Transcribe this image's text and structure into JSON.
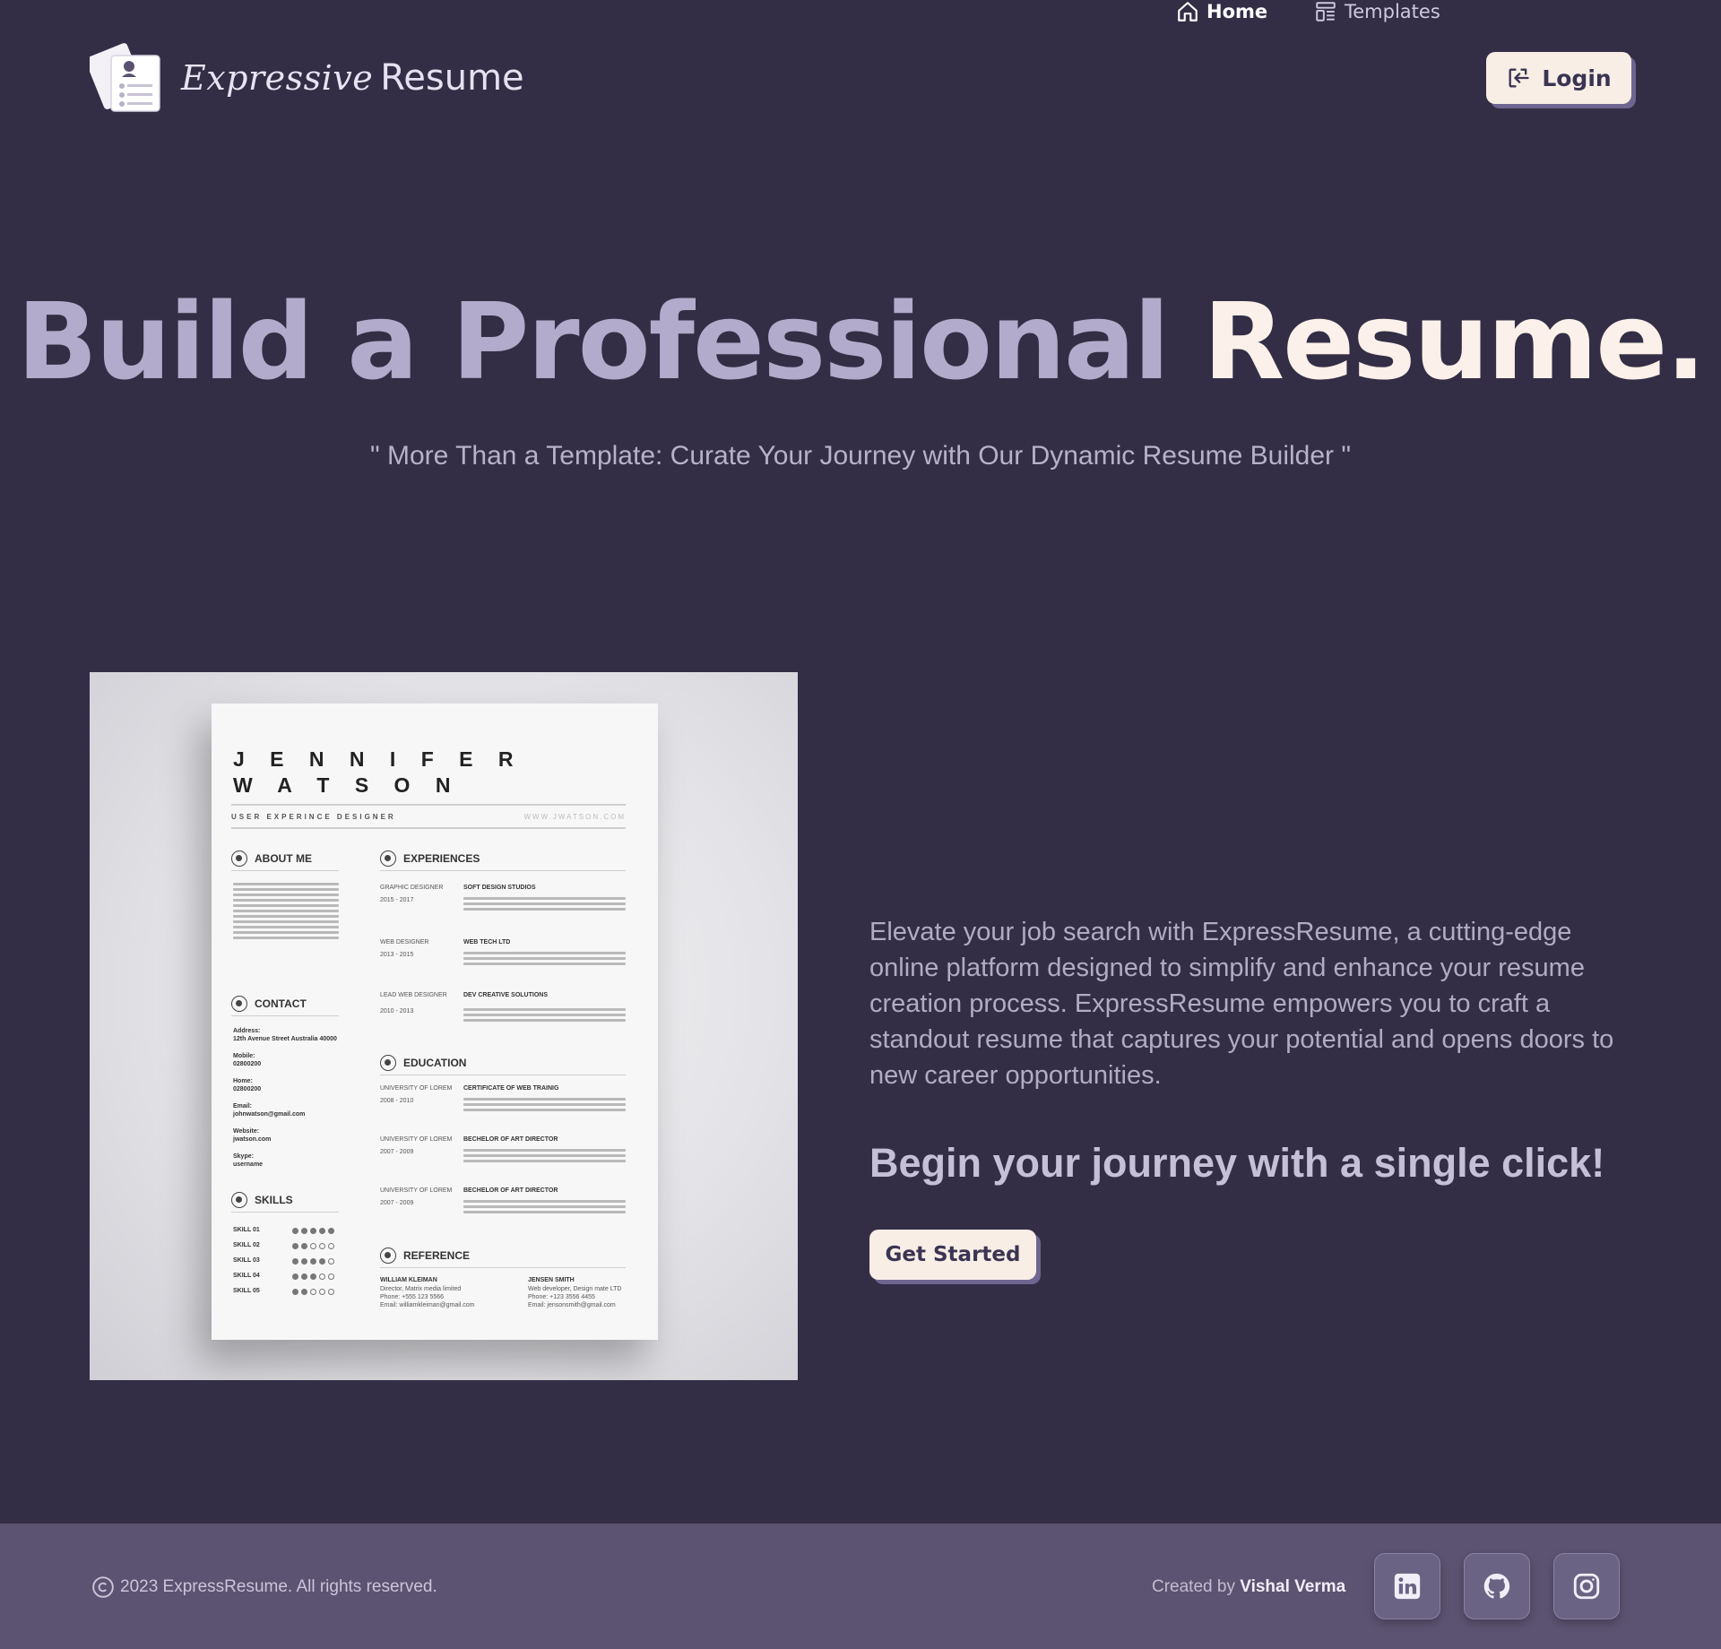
{
  "header": {
    "logo_script": "Expressive",
    "logo_word": "Resume",
    "nav": {
      "home": "Home",
      "templates": "Templates"
    },
    "login_label": "Login"
  },
  "hero": {
    "title_part1": "Build a Professional",
    "title_part2": "Resume.",
    "subtitle": "\" More Than a Template: Curate Your Journey with Our Dynamic Resume Builder \""
  },
  "resume_preview": {
    "name_line1": "J E N N I F E R",
    "name_line2": "W A T S O N",
    "role": "USER EXPERINCE DESIGNER",
    "website": "WWW.JWATSON.COM",
    "sections": {
      "about": "ABOUT ME",
      "experiences": "EXPERIENCES",
      "contact": "CONTACT",
      "education": "EDUCATION",
      "skills": "SKILLS",
      "reference": "REFERENCE"
    },
    "contact": {
      "address_label": "Address:",
      "address": "12th Avenue Street Australia 40000",
      "mobile_label": "Mobile:",
      "mobile": "02800200",
      "home_label": "Home:",
      "home": "02800200",
      "email_label": "Email:",
      "email": "johnwatson@gmail.com",
      "website_label": "Website:",
      "website": "jwatson.com",
      "skype_label": "Skype:",
      "skype": "username"
    },
    "experiences": [
      {
        "role": "GRAPHIC DESIGNER",
        "years": "2015 - 2017",
        "company": "SOFT DESIGN STUDIOS"
      },
      {
        "role": "WEB DESIGNER",
        "years": "2013 - 2015",
        "company": "WEB TECH LTD"
      },
      {
        "role": "LEAD WEB DESIGNER",
        "years": "2010 - 2013",
        "company": "DEV CREATIVE SOLUTIONS"
      }
    ],
    "education": [
      {
        "school": "UNIVERSITY OF LOREM",
        "years": "2008 - 2010",
        "degree": "CERTIFICATE OF WEB TRAINIG"
      },
      {
        "school": "UNIVERSITY OF LOREM",
        "years": "2007 - 2009",
        "degree": "BECHELOR OF ART DIRECTOR"
      },
      {
        "school": "UNIVERSITY OF LOREM",
        "years": "2007 - 2009",
        "degree": "BECHELOR OF ART DIRECTOR"
      }
    ],
    "skills": [
      {
        "name": "SKILL 01",
        "level": 5
      },
      {
        "name": "SKILL 02",
        "level": 2
      },
      {
        "name": "SKILL 03",
        "level": 4
      },
      {
        "name": "SKILL 04",
        "level": 3
      },
      {
        "name": "SKILL 05",
        "level": 2
      }
    ],
    "references": [
      {
        "name": "WILLIAM KLEIMAN",
        "title": "Director, Matrix media limited",
        "phone": "Phone: +555 123 5566",
        "email": "Email: williamkleiman@gmail.com"
      },
      {
        "name": "JENSEN SMITH",
        "title": "Web developer, Design mate LTD",
        "phone": "Phone: +123 3556 4455",
        "email": "Email: jensonsmith@gmail.com"
      }
    ]
  },
  "main": {
    "description": "Elevate your job search with ExpressResume, a cutting-edge online platform designed to simplify and enhance your resume creation process. ExpressResume empowers you to craft a standout resume that captures your potential and opens doors to new career opportunities.",
    "cta_heading": "Begin your journey with a single click!",
    "cta_button": "Get Started"
  },
  "footer": {
    "copyright": "2023 ExpressResume. All rights reserved.",
    "credit_prefix": "Created by",
    "credit_name": "Vishal Verma",
    "social_icons": [
      "linkedin-icon",
      "github-icon",
      "instagram-icon"
    ]
  },
  "colors": {
    "background": "#332e45",
    "footer": "#5c5372",
    "button": "#f8eee6",
    "button_shadow": "#6e6690",
    "title_light": "#b3abcb",
    "title_accent": "#fbf1ea"
  }
}
